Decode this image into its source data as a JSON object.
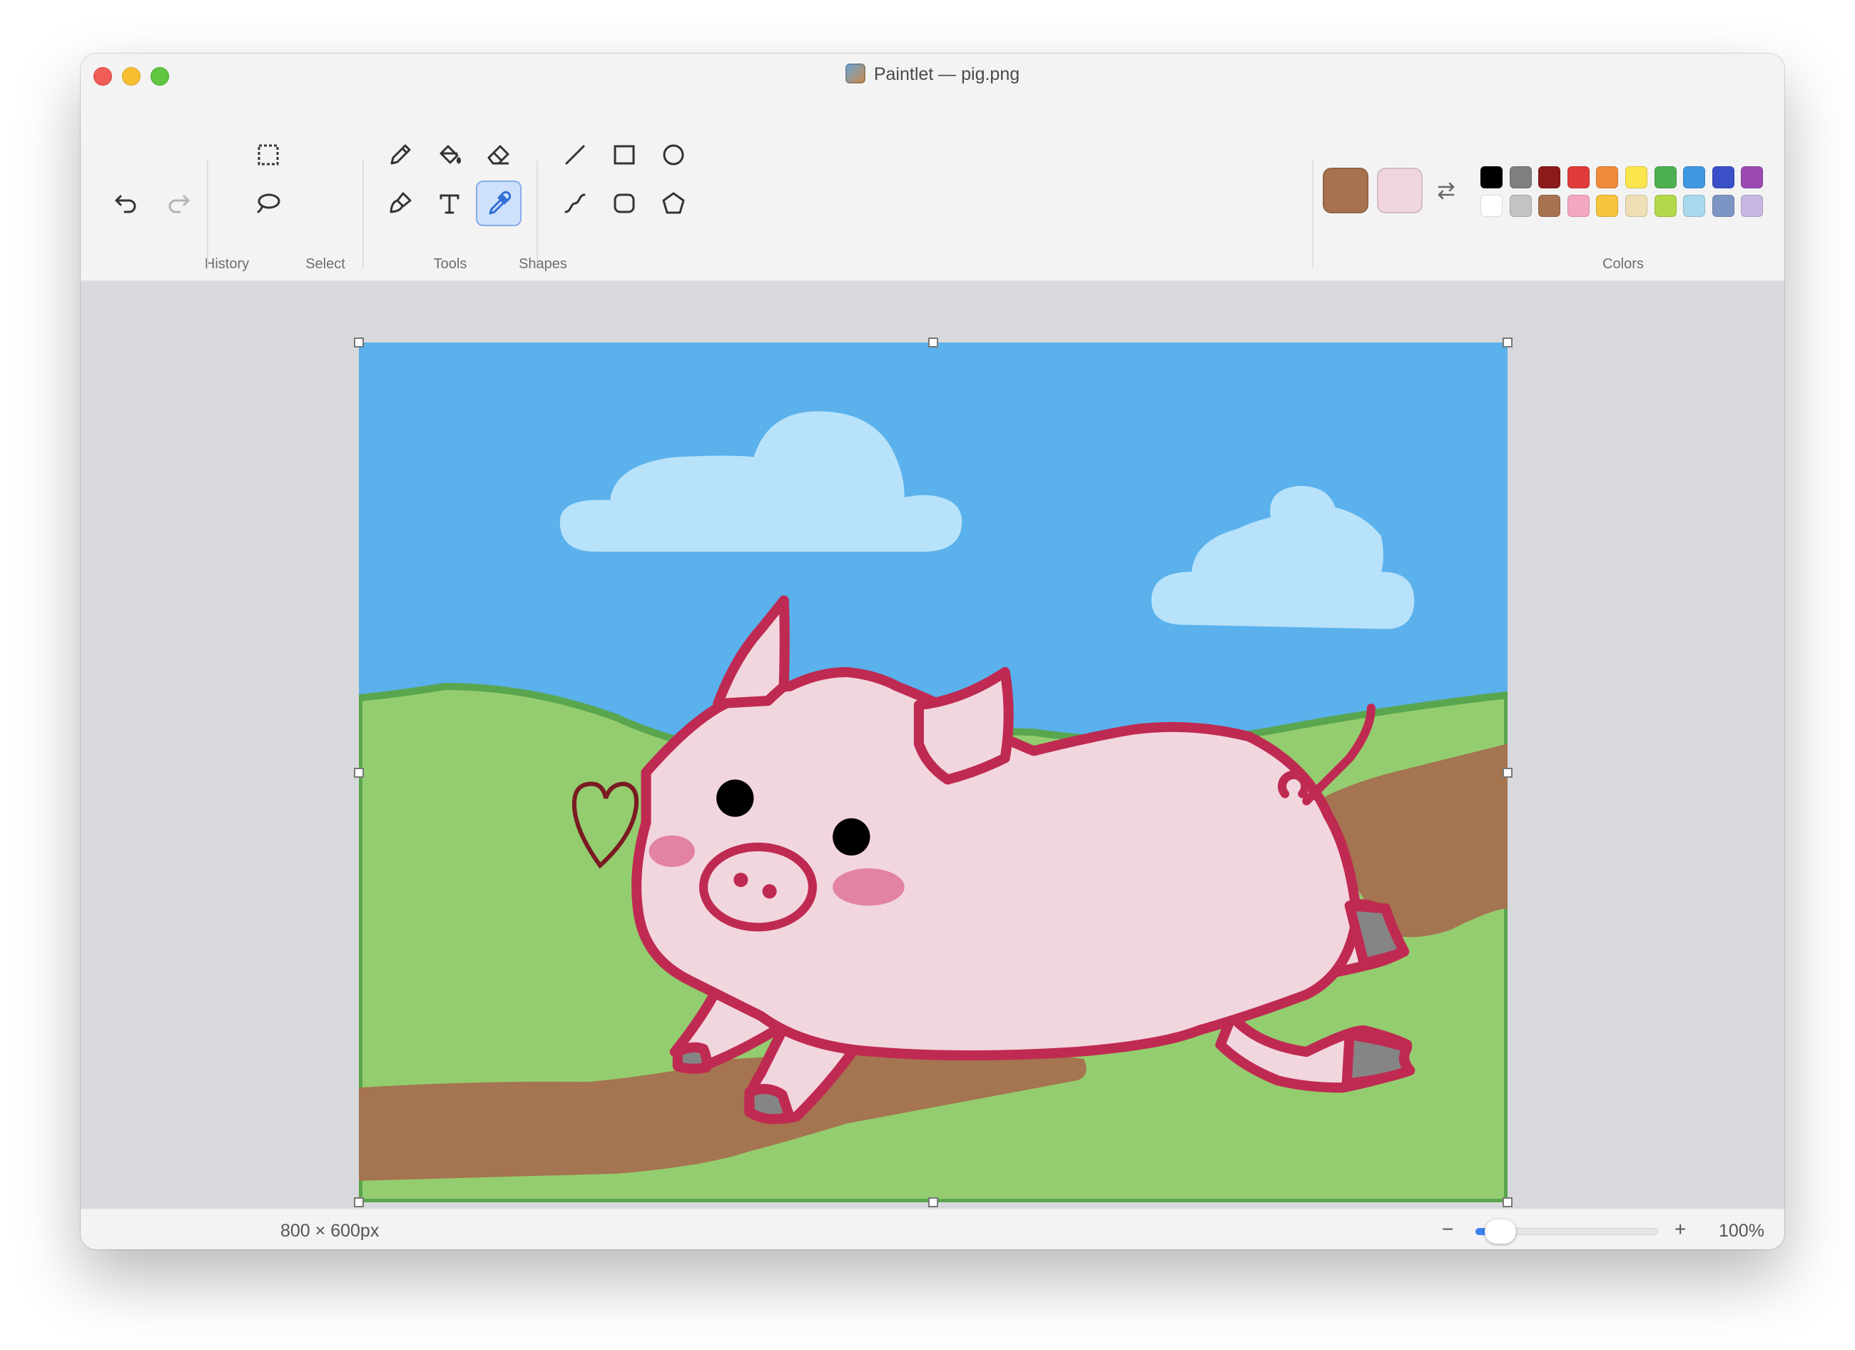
{
  "window": {
    "title": "Paintlet — pig.png"
  },
  "toolbar": {
    "groups": {
      "history": "History",
      "select": "Select",
      "tools": "Tools",
      "shapes": "Shapes",
      "colors": "Colors"
    },
    "active_tool": "color-picker",
    "primary_color": "#a6724f",
    "secondary_color": "#f1d6de",
    "palette_row1": [
      "#000000",
      "#7f7f7f",
      "#8b1a1a",
      "#e03b3b",
      "#f08a3a",
      "#fbe54d",
      "#4caf50",
      "#3f97e0",
      "#3b4fc9",
      "#9a4ab0"
    ],
    "palette_row2": [
      "#ffffff",
      "#c3c3c3",
      "#a6724f",
      "#f4a7c0",
      "#f7c43d",
      "#efdfb5",
      "#b2d94a",
      "#a8d8ec",
      "#7d95c4",
      "#c6b8e0"
    ]
  },
  "canvas": {
    "sky": "#5ab1ec",
    "hill": "#94cd6f",
    "hill_edge": "#5aa64f",
    "path": "#a57450",
    "cloud": "#b8e2fa",
    "pig_fill": "#f2d6de",
    "outline": "#bf2a52",
    "cheek": "#e283a4",
    "hoof": "#858585",
    "heart": "#7a1a22"
  },
  "status": {
    "dimensions": "800 × 600px",
    "zoom_minus": "−",
    "zoom_plus": "+",
    "zoom_label": "100%",
    "zoom_fraction": 0.05
  }
}
